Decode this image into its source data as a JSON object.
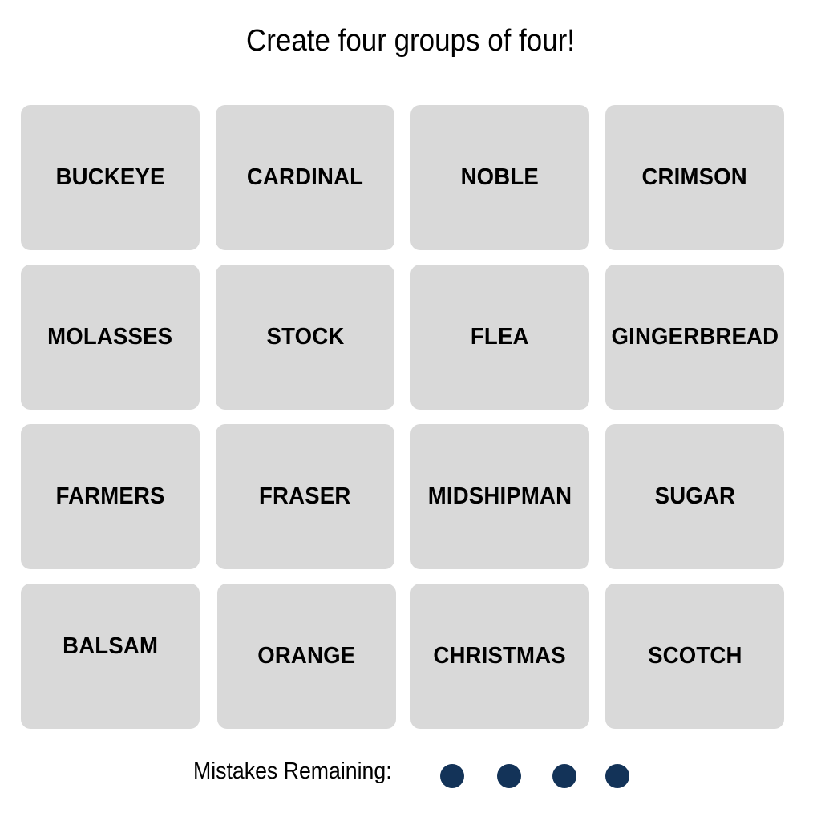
{
  "title": "Create four groups of four!",
  "tiles": [
    "BUCKEYE",
    "CARDINAL",
    "NOBLE",
    "CRIMSON",
    "MOLASSES",
    "STOCK",
    "FLEA",
    "GINGERBREAD",
    "FARMERS",
    "FRASER",
    "MIDSHIPMAN",
    "SUGAR",
    "BALSAM",
    "ORANGE",
    "CHRISTMAS",
    "SCOTCH"
  ],
  "mistakes": {
    "label": "Mistakes Remaining:",
    "remaining": 4,
    "dot_color": "#133358"
  }
}
